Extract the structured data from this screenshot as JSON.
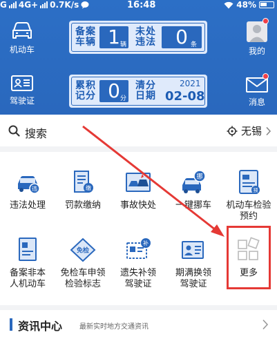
{
  "status": {
    "carrier_left": "G",
    "network": "4G+",
    "speed": "0.7K/s",
    "time": "16:48",
    "battery": "48%"
  },
  "header": {
    "left_top_label": "机动车",
    "left_bottom_label": "驾驶证",
    "right_top_label": "我的",
    "right_bottom_label": "消息",
    "panel1": {
      "label_a": "备案车辆",
      "value_a": "1",
      "unit_a": "辆",
      "label_b": "未处违法",
      "value_b": "0",
      "unit_b": "条"
    },
    "panel2": {
      "label_a": "累积记分",
      "value_a": "0",
      "unit_a": "分",
      "label_b": "清分日期",
      "year": "2021",
      "date": "02-08"
    }
  },
  "search": {
    "label": "搜索",
    "city": "无锡"
  },
  "services": [
    {
      "label": "违法处理",
      "icon": "violation-icon"
    },
    {
      "label": "罚款缴纳",
      "icon": "fine-payment-icon"
    },
    {
      "label": "事故快处",
      "icon": "accident-icon"
    },
    {
      "label": "一键挪车",
      "icon": "move-car-icon"
    },
    {
      "label": "机动车检验预约",
      "icon": "inspection-booking-icon"
    },
    {
      "label": "备案非本人机动车",
      "icon": "register-vehicle-icon"
    },
    {
      "label": "免检车申领检验标志",
      "icon": "exempt-sticker-icon"
    },
    {
      "label": "遗失补领驾驶证",
      "icon": "license-reissue-icon"
    },
    {
      "label": "期满换领驾驶证",
      "icon": "license-renewal-icon"
    },
    {
      "label": "更多",
      "icon": "more-grid-icon"
    }
  ],
  "news": {
    "title": "资讯中心",
    "subtitle": "最新实时地方交通资讯"
  },
  "colors": {
    "header_blue": "#2a68bd",
    "highlight_red": "#e53935",
    "notification_dot": "#f0404a"
  }
}
